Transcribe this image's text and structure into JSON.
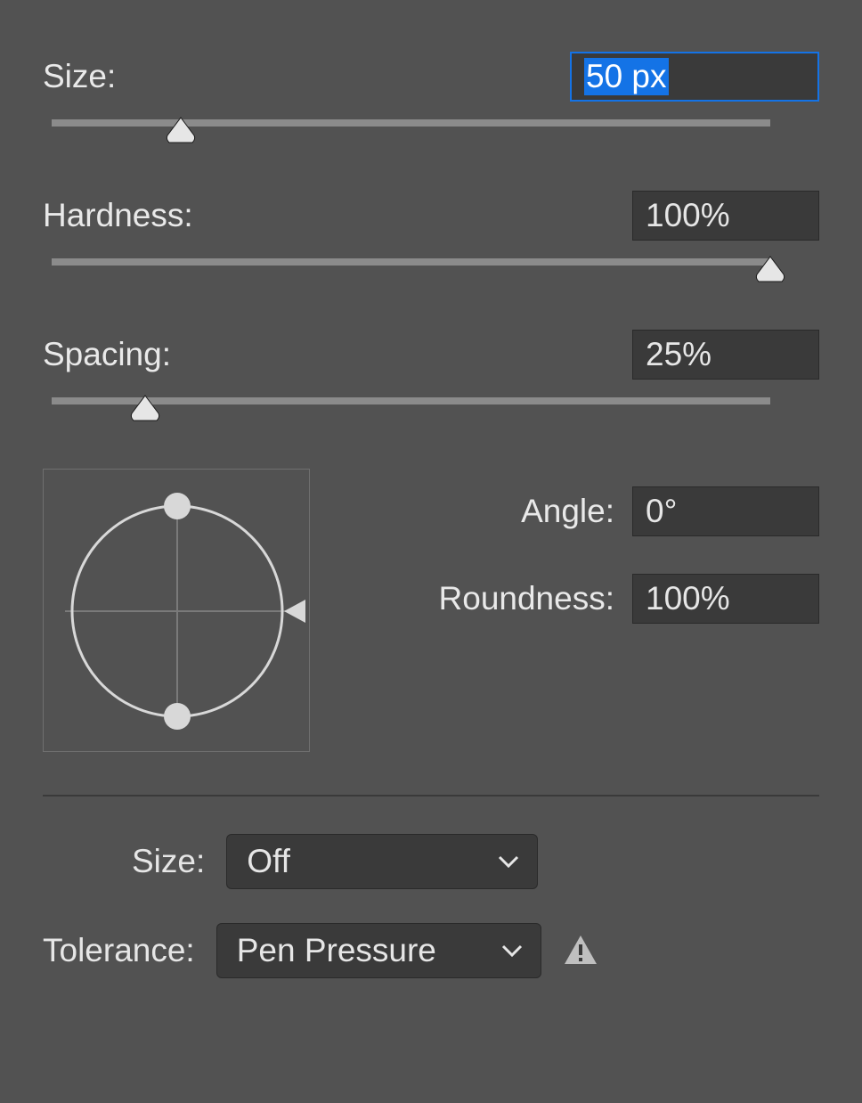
{
  "brush": {
    "size_label": "Size:",
    "size_value": "50 px",
    "size_percent": 18,
    "hardness_label": "Hardness:",
    "hardness_value": "100%",
    "hardness_percent": 100,
    "spacing_label": "Spacing:",
    "spacing_value": "25%",
    "spacing_percent": 13
  },
  "shape": {
    "angle_label": "Angle:",
    "angle_value": "0°",
    "roundness_label": "Roundness:",
    "roundness_value": "100%"
  },
  "dynamics": {
    "size_label": "Size:",
    "size_value": "Off",
    "tolerance_label": "Tolerance:",
    "tolerance_value": "Pen Pressure"
  }
}
